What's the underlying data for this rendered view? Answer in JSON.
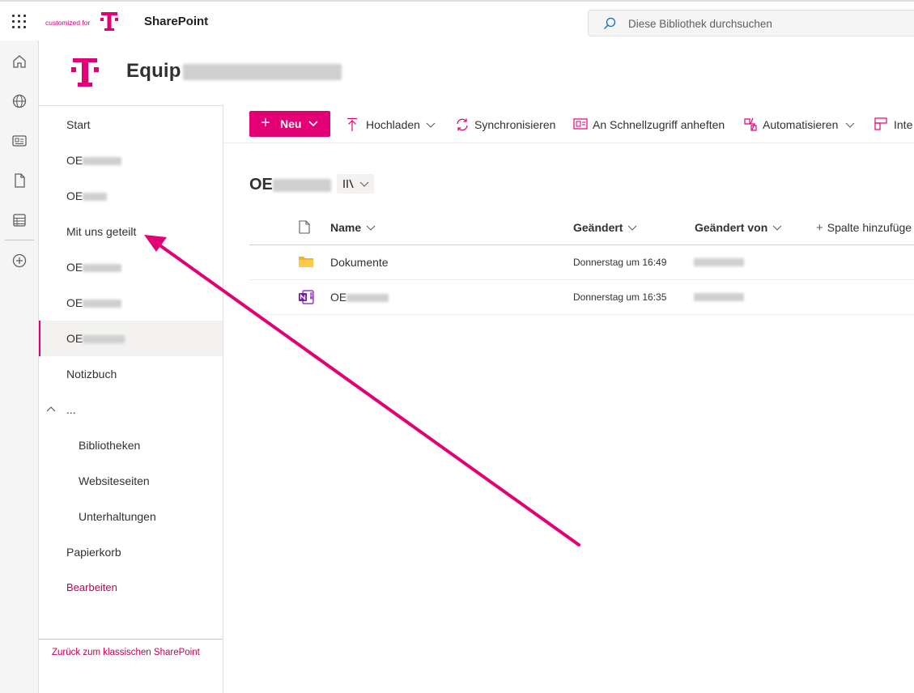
{
  "suitebar": {
    "customized_for": "customized for",
    "app_name": "SharePoint",
    "search_placeholder": "Diese Bibliothek durchsuchen"
  },
  "site": {
    "title_visible": "Equip"
  },
  "leftnav": {
    "items": [
      {
        "label": "Start"
      },
      {
        "label": "OE"
      },
      {
        "label": "OE"
      },
      {
        "label": "Mit uns geteilt"
      },
      {
        "label": "OE"
      },
      {
        "label": "OE"
      },
      {
        "label": "OE"
      },
      {
        "label": "Notizbuch"
      },
      {
        "label": "..."
      },
      {
        "label": "Bibliotheken"
      },
      {
        "label": "Websiteseiten"
      },
      {
        "label": "Unterhaltungen"
      },
      {
        "label": "Papierkorb"
      },
      {
        "label": "Bearbeiten"
      }
    ],
    "footer": "Zurück zum klassischen SharePoint"
  },
  "commandbar": {
    "new": "Neu",
    "upload": "Hochladen",
    "sync": "Synchronisieren",
    "pin": "An Schnellzugriff anheften",
    "automate": "Automatisieren",
    "integrate": "Inte"
  },
  "library": {
    "title_visible": "OE",
    "columns": {
      "name": "Name",
      "modified": "Geändert",
      "modified_by": "Geändert von",
      "add_column": "Spalte hinzufüge"
    },
    "rows": [
      {
        "icon": "folder-icon",
        "name": "Dokumente",
        "modified": "Donnerstag um 16:49"
      },
      {
        "icon": "onenote-icon",
        "name": "OE",
        "modified": "Donnerstag um 16:35"
      }
    ]
  },
  "colors": {
    "brand": "#e20074",
    "link": "#c30052",
    "folder": "#f0b429",
    "onenote": "#7719aa"
  }
}
